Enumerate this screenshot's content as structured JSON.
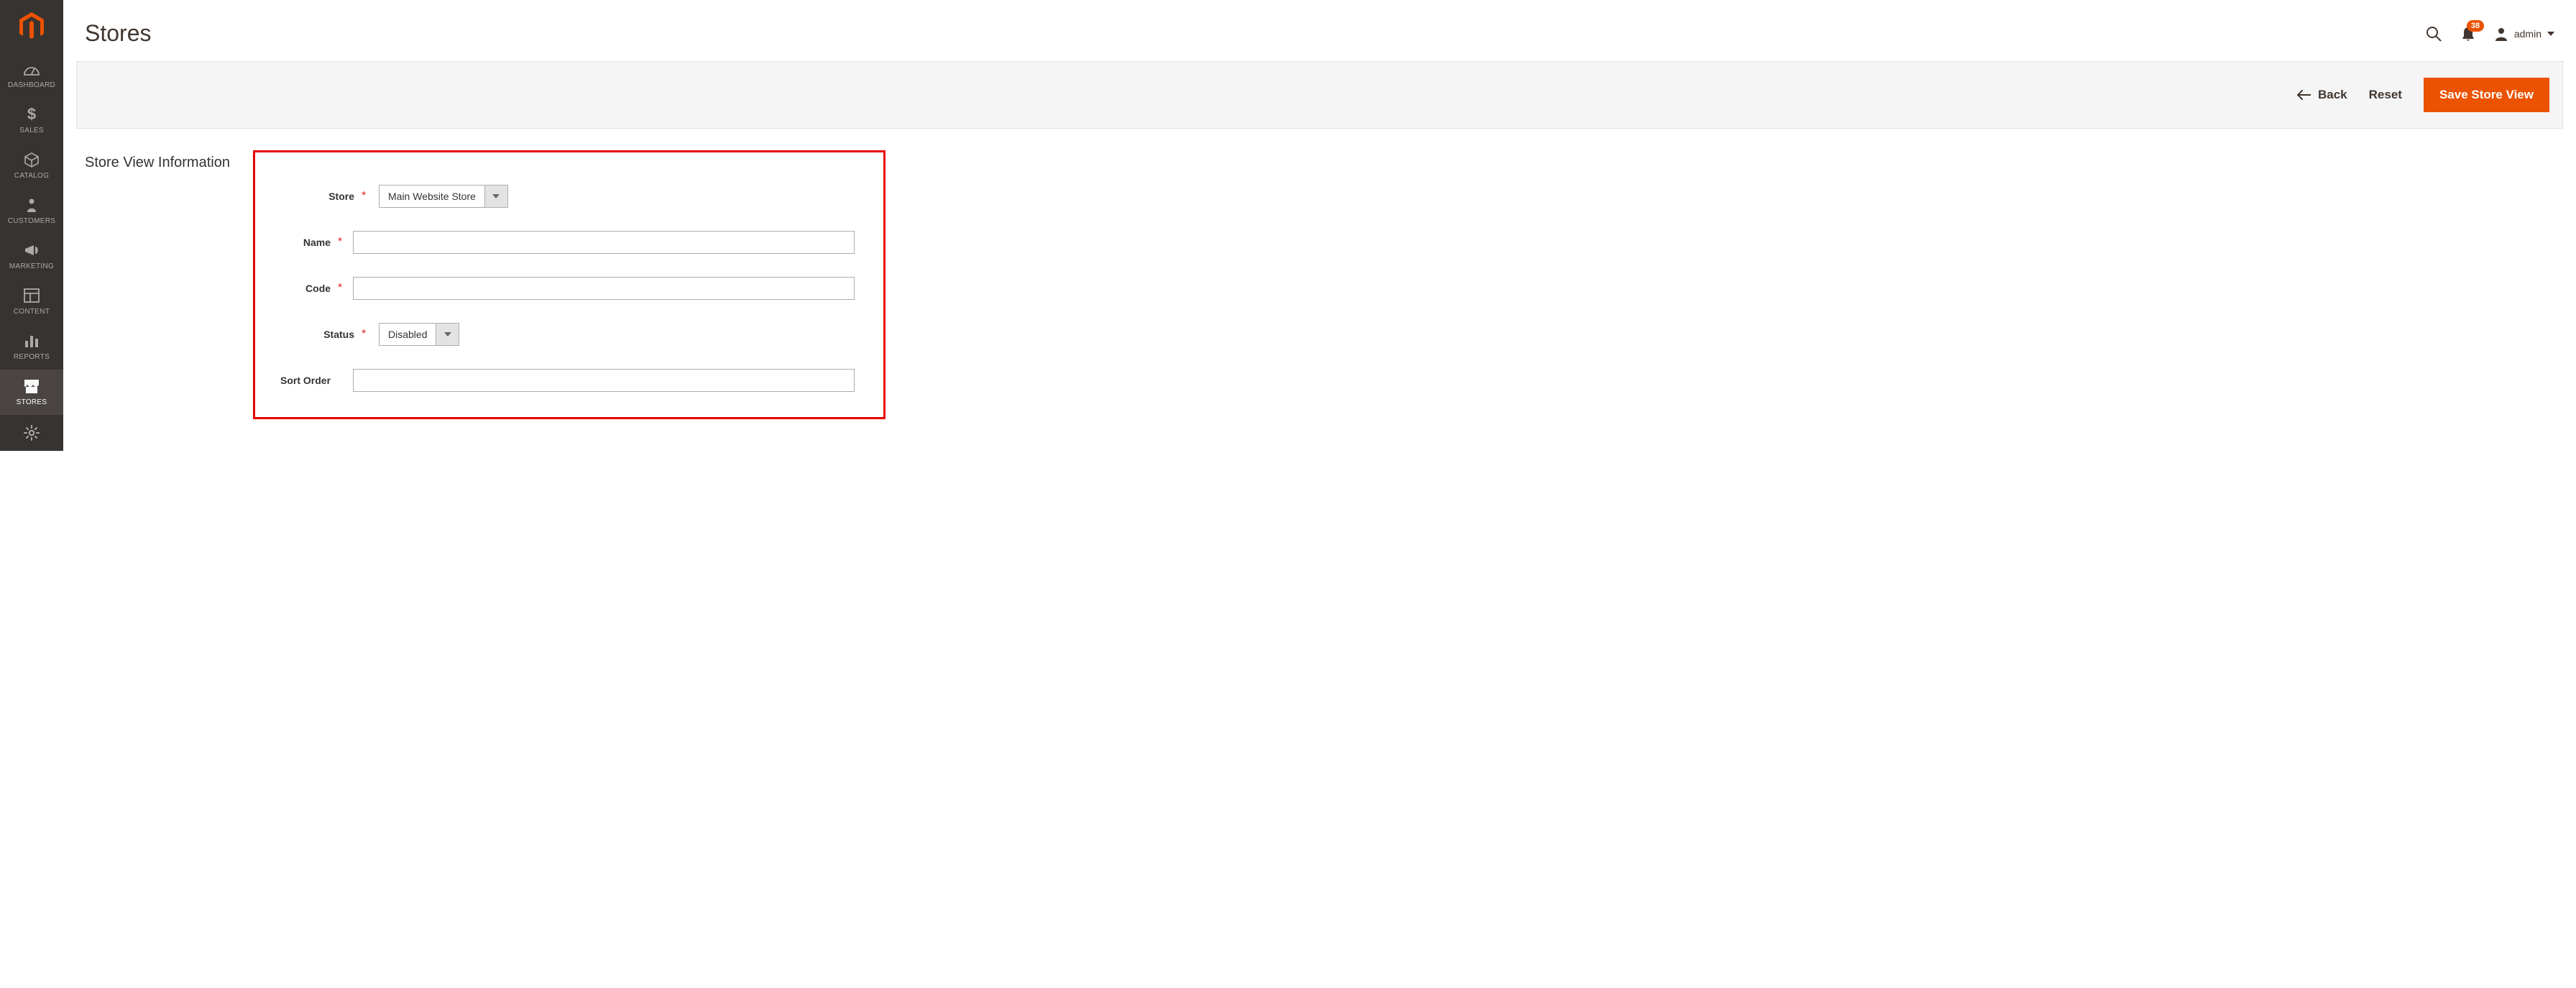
{
  "page": {
    "title": "Stores"
  },
  "header": {
    "notification_count": "38",
    "username": "admin"
  },
  "sidebar": {
    "items": [
      {
        "label": "DASHBOARD"
      },
      {
        "label": "SALES"
      },
      {
        "label": "CATALOG"
      },
      {
        "label": "CUSTOMERS"
      },
      {
        "label": "MARKETING"
      },
      {
        "label": "CONTENT"
      },
      {
        "label": "REPORTS"
      },
      {
        "label": "STORES"
      }
    ]
  },
  "actions": {
    "back": "Back",
    "reset": "Reset",
    "save": "Save Store View"
  },
  "section": {
    "title": "Store View Information"
  },
  "form": {
    "store": {
      "label": "Store",
      "value": "Main Website Store"
    },
    "name": {
      "label": "Name",
      "value": ""
    },
    "code": {
      "label": "Code",
      "value": ""
    },
    "status": {
      "label": "Status",
      "value": "Disabled"
    },
    "sort_order": {
      "label": "Sort Order",
      "value": ""
    }
  }
}
